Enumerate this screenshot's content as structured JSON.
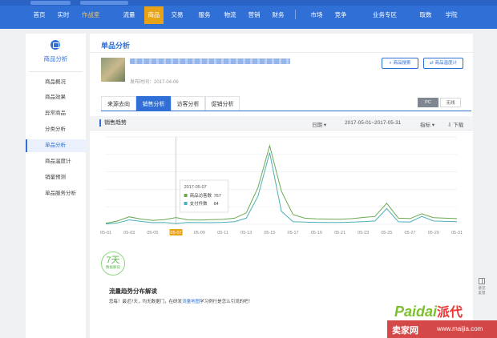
{
  "nav": {
    "items": [
      "首页",
      "实时",
      "作战室",
      "流量",
      "商品",
      "交易",
      "服务",
      "物流",
      "营销",
      "财务",
      "市场",
      "竞争",
      "业务专区",
      "取数",
      "学院"
    ],
    "active": "商品"
  },
  "sidebar": {
    "title": "商品分析",
    "items": [
      {
        "label": "商品概况"
      },
      {
        "label": "商品效果"
      },
      {
        "label": "异常商品"
      },
      {
        "label": "分类分析"
      },
      {
        "label": "单品分析",
        "active": true
      },
      {
        "label": "商品温度计"
      },
      {
        "label": "销量预测"
      },
      {
        "label": "单品服务分析"
      }
    ]
  },
  "main": {
    "title": "单品分析",
    "publish_time": "发布时间：2017-04-06",
    "buttons": {
      "search": "商品搜索",
      "thermometer": "商品温度计"
    },
    "tabs": [
      "来源去向",
      "销售分析",
      "访客分析",
      "促销分析"
    ],
    "active_tab": "销售分析",
    "device": {
      "pc": "PC",
      "wireless": "无线",
      "active": "PC"
    },
    "trend": {
      "title": "销售趋势",
      "granularity": "日期",
      "date_range": "2017-05-01~2017-05-31",
      "indicator": "指标",
      "download": "下载"
    }
  },
  "chart_data": {
    "type": "line",
    "x": [
      "05-01",
      "05-02",
      "05-03",
      "05-04",
      "05-05",
      "05-06",
      "05-07",
      "05-08",
      "05-09",
      "05-10",
      "05-11",
      "05-12",
      "05-13",
      "05-14",
      "05-15",
      "05-16",
      "05-17",
      "05-18",
      "05-19",
      "05-20",
      "05-21",
      "05-22",
      "05-23",
      "05-24",
      "05-25",
      "05-26",
      "05-27",
      "05-28",
      "05-29",
      "05-30",
      "05-31"
    ],
    "tick_labels": [
      "05-01",
      "05-03",
      "05-05",
      "05-07",
      "05-09",
      "05-11",
      "05-13",
      "05-15",
      "05-17",
      "05-19",
      "05-21",
      "05-23",
      "05-25",
      "05-27",
      "05-29",
      "05-31"
    ],
    "series": [
      {
        "name": "商品访客数",
        "color": "#6aa84f",
        "values": [
          120,
          380,
          850,
          600,
          450,
          520,
          767,
          500,
          480,
          520,
          560,
          700,
          1300,
          4200,
          9000,
          3800,
          1100,
          700,
          620,
          600,
          580,
          640,
          780,
          900,
          2400,
          700,
          650,
          1200,
          760,
          700,
          650
        ]
      },
      {
        "name": "支付件数",
        "color": "#4ab0b8",
        "values": [
          40,
          160,
          500,
          330,
          180,
          210,
          84,
          200,
          190,
          180,
          220,
          300,
          700,
          3200,
          8200,
          1500,
          300,
          250,
          220,
          210,
          200,
          240,
          300,
          380,
          1800,
          280,
          260,
          900,
          380,
          330,
          300
        ]
      }
    ],
    "tooltip": {
      "date": "2017-05-07",
      "rows": [
        {
          "label": "商品访客数",
          "value": "767"
        },
        {
          "label": "支付件数",
          "value": "84"
        }
      ]
    },
    "highlight_x": "05-07",
    "grid": true
  },
  "insight": {
    "badge_big": "7天",
    "badge_small": "数据解读",
    "title": "流量趋势分布解读",
    "text_pre": "您每！最近7天，均无数据门，在研发",
    "text_link": "流量地图",
    "text_post": "学习例行是怎么引流的吧！"
  },
  "float_tool": {
    "label": "意见\n反馈"
  },
  "watermark": {
    "brand": "Paidai",
    "brand_cn": "派代",
    "left": "卖家网",
    "right": "www.maijia.com"
  }
}
